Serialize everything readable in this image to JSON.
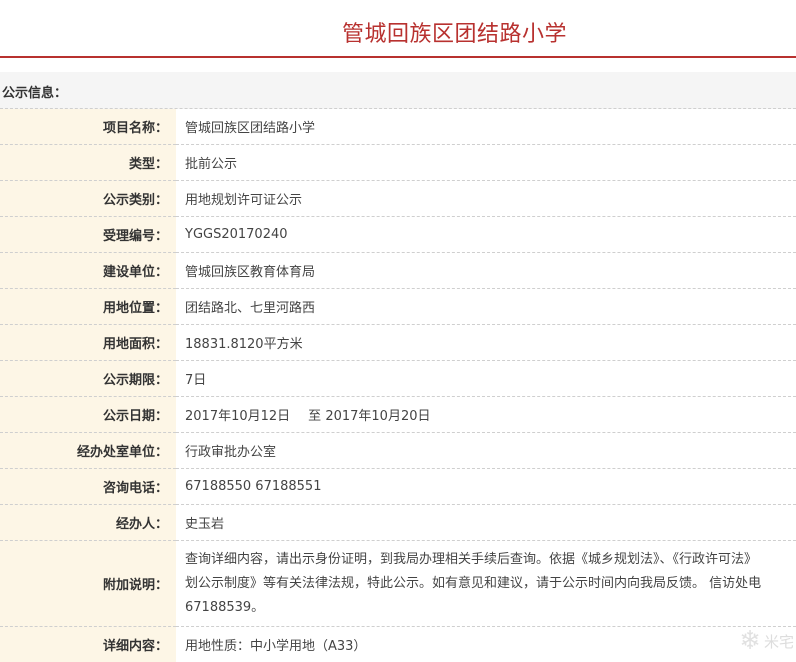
{
  "header": {
    "title": "管城回族区团结路小学"
  },
  "section": {
    "title": "公示信息："
  },
  "rows": {
    "project_name": {
      "label": "项目名称：",
      "value": "管城回族区团结路小学"
    },
    "type": {
      "label": "类型：",
      "value": "批前公示"
    },
    "category": {
      "label": "公示类别：",
      "value": "用地规划许可证公示"
    },
    "accept_no": {
      "label": "受理编号：",
      "value": "YGGS20170240"
    },
    "builder": {
      "label": "建设单位：",
      "value": "管城回族区教育体育局"
    },
    "location": {
      "label": "用地位置：",
      "value": "团结路北、七里河路西"
    },
    "area": {
      "label": "用地面积：",
      "value": "18831.8120平方米"
    },
    "period": {
      "label": "公示期限：",
      "value": "7日"
    },
    "date": {
      "label": "公示日期：",
      "start": "2017年10月12日",
      "sep": "至",
      "end": "2017年10月20日"
    },
    "office": {
      "label": "经办处室单位：",
      "value": "行政审批办公室"
    },
    "phone": {
      "label": "咨询电话：",
      "value": "67188550 67188551"
    },
    "handler": {
      "label": "经办人：",
      "value": "史玉岩"
    },
    "note": {
      "label": "附加说明：",
      "line1": "查询详细内容，请出示身份证明，到我局办理相关手续后查询。依据《城乡规划法》、《行政许可法》",
      "line2": "划公示制度》等有关法律法规，特此公示。如有意见和建议，请于公示时间内向我局反馈。 信访处电",
      "line3": "67188539。"
    },
    "detail": {
      "label": "详细内容：",
      "value": "用地性质：中小学用地（A33）"
    }
  },
  "watermark": {
    "icon": "snowflake-icon",
    "text": "米宅"
  }
}
